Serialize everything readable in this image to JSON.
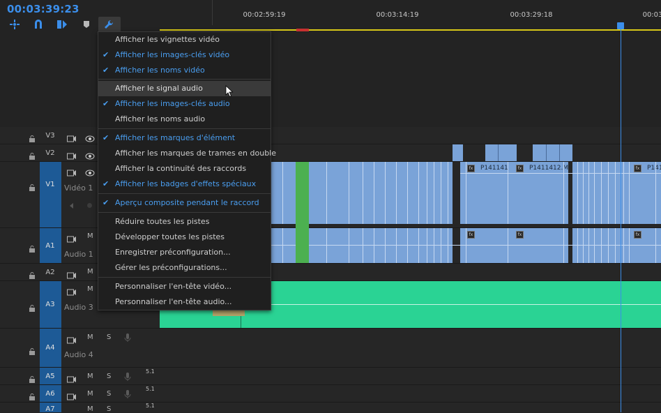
{
  "timecode": "00:03:39:23",
  "ruler": {
    "labels": [
      "00:02:59:19",
      "00:03:14:19",
      "00:03:29:18",
      "00:03"
    ]
  },
  "tracks": {
    "v3": {
      "name": "V3"
    },
    "v2": {
      "name": "V2"
    },
    "v1": {
      "name": "V1",
      "label": "Vidéo 1"
    },
    "a1": {
      "name": "A1",
      "label": "Audio 1",
      "m": "M"
    },
    "a2": {
      "name": "A2",
      "m": "M"
    },
    "a3": {
      "name": "A3",
      "label": "Audio 3",
      "m": "M"
    },
    "a4": {
      "name": "A4",
      "label": "Audio 4",
      "m": "M",
      "s": "S"
    },
    "a5": {
      "name": "A5",
      "m": "M",
      "s": "S",
      "ch": "5.1"
    },
    "a6": {
      "name": "A6",
      "m": "M",
      "s": "S",
      "ch": "5.1"
    },
    "a7": {
      "name": "A7",
      "m": "M",
      "s": "S",
      "ch": "5.1"
    }
  },
  "clips": {
    "c1": "P141141",
    "c2": "P1411412.M",
    "c3": "P141"
  },
  "menu": {
    "items": [
      {
        "label": "Afficher les vignettes vidéo",
        "checked": false
      },
      {
        "label": "Afficher les images-clés vidéo",
        "checked": true
      },
      {
        "label": "Afficher les noms vidéo",
        "checked": true
      },
      {
        "label": "Afficher le signal audio",
        "checked": false
      },
      {
        "label": "Afficher les images-clés audio",
        "checked": true
      },
      {
        "label": "Afficher les noms audio",
        "checked": false
      },
      {
        "label": "Afficher les marques d'élément",
        "checked": true
      },
      {
        "label": "Afficher les marques de trames en double",
        "checked": false
      },
      {
        "label": "Afficher la continuité des raccords",
        "checked": false
      },
      {
        "label": "Afficher les badges d'effets spéciaux",
        "checked": true
      },
      {
        "label": "Aperçu composite pendant le raccord",
        "checked": true
      },
      {
        "label": "Réduire toutes les pistes",
        "checked": false
      },
      {
        "label": "Développer toutes les pistes",
        "checked": false
      },
      {
        "label": "Enregistrer préconfiguration...",
        "checked": false
      },
      {
        "label": "Gérer les préconfigurations...",
        "checked": false
      },
      {
        "label": "Personnaliser l'en-tête vidéo...",
        "checked": false
      },
      {
        "label": "Personnaliser l'en-tête audio...",
        "checked": false
      }
    ]
  },
  "colors": {
    "accent": "#3b8eea",
    "video_clip": "#7aa3d8",
    "audio_clip": "#2ad394",
    "marker_green": "#4cb050"
  }
}
